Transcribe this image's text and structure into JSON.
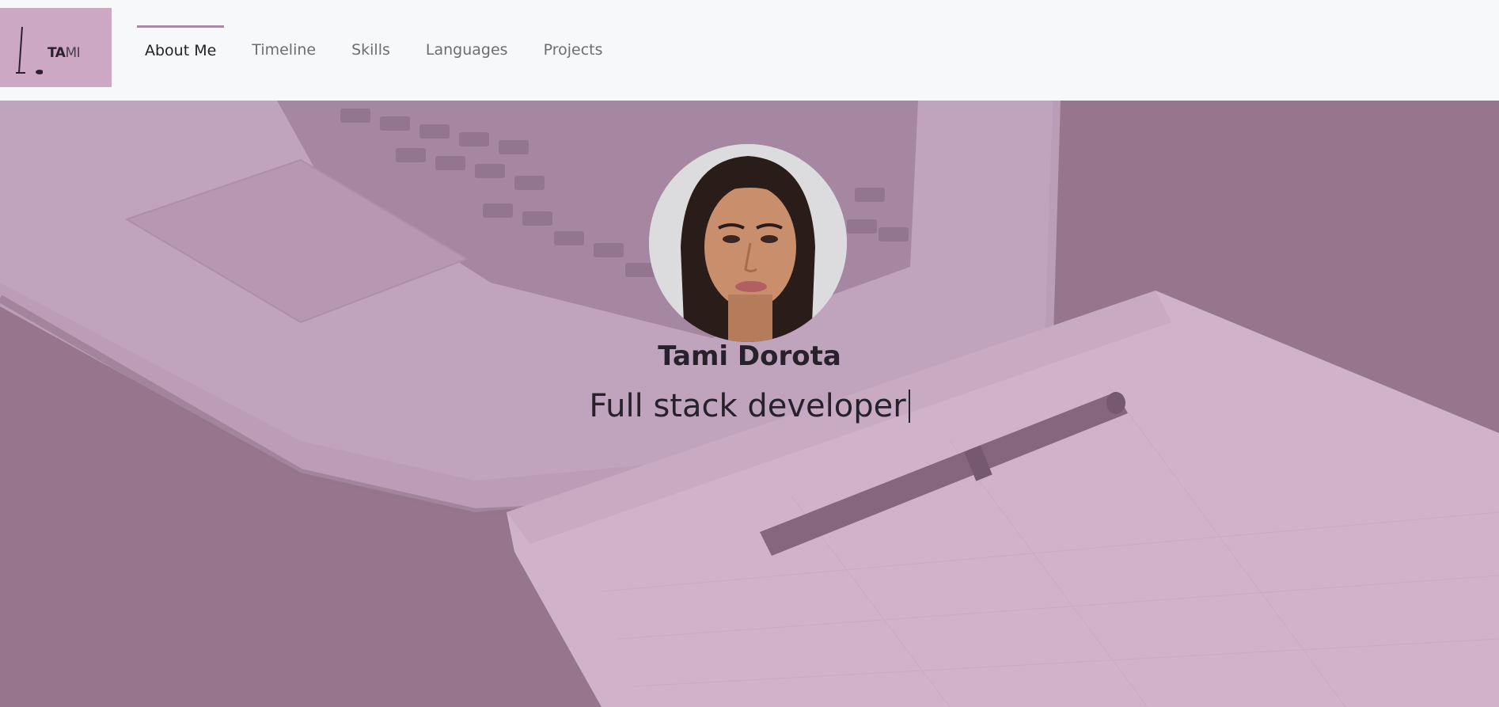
{
  "brand": {
    "logo_bold": "TA",
    "logo_light": "MI",
    "bg_color": "#cda8c4"
  },
  "nav": {
    "items": [
      {
        "label": "About Me",
        "active": true
      },
      {
        "label": "Timeline",
        "active": false
      },
      {
        "label": "Skills",
        "active": false
      },
      {
        "label": "Languages",
        "active": false
      },
      {
        "label": "Projects",
        "active": false
      }
    ]
  },
  "hero": {
    "name": "Tami Dorota",
    "role": "Full stack developer",
    "avatar_icon": "profile-photo"
  },
  "colors": {
    "accent": "#a689a2",
    "overlay": "#c9a8c2",
    "text": "#27212c"
  }
}
